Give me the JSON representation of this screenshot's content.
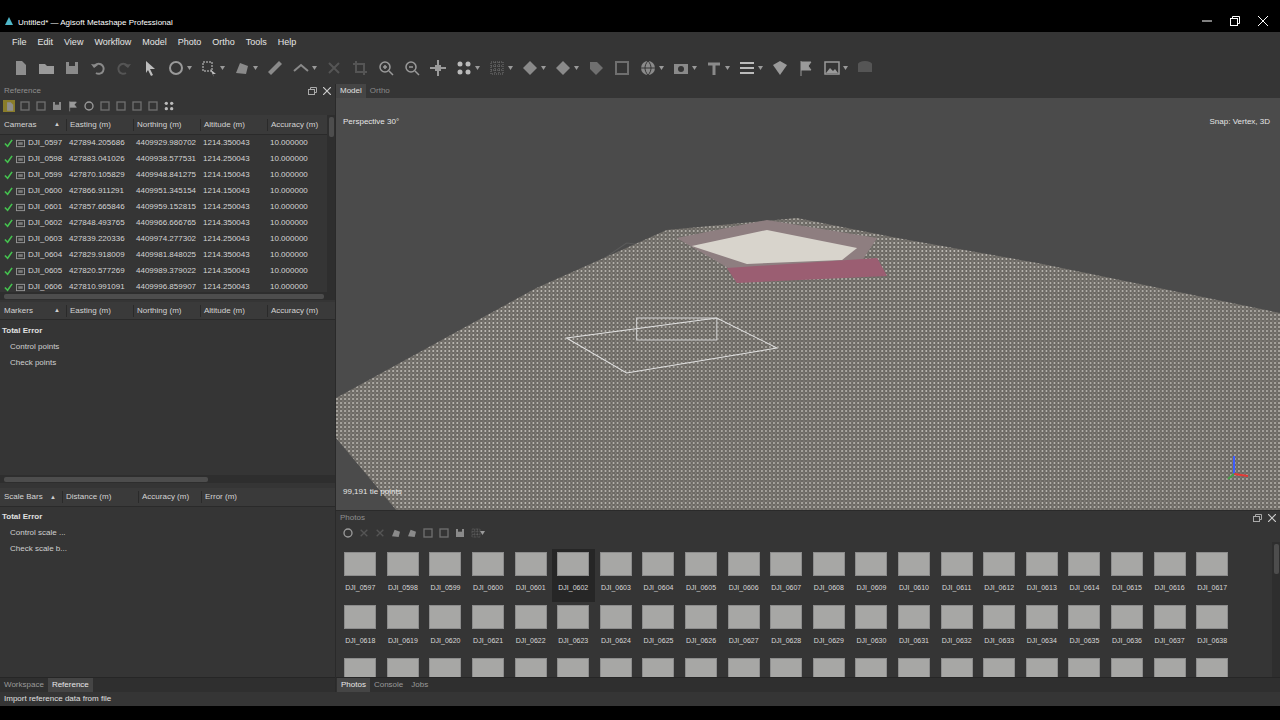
{
  "window": {
    "title": "Untitled* — Agisoft Metashape Professional"
  },
  "menu": [
    "File",
    "Edit",
    "View",
    "Workflow",
    "Model",
    "Photo",
    "Ortho",
    "Tools",
    "Help"
  ],
  "reference": {
    "title": "Reference",
    "import_hovered": true,
    "cameras": {
      "title": "Cameras",
      "sort": "▲",
      "columns": [
        "Easting (m)",
        "Northing (m)",
        "Altitude (m)",
        "Accuracy (m)"
      ],
      "rows": [
        {
          "name": "DJI_0597",
          "checked": true,
          "easting": "427894.205686",
          "northing": "4409929.980702",
          "altitude": "1214.350043",
          "accuracy": "10.000000"
        },
        {
          "name": "DJI_0598",
          "checked": true,
          "easting": "427883.041026",
          "northing": "4409938.577531",
          "altitude": "1214.250043",
          "accuracy": "10.000000"
        },
        {
          "name": "DJI_0599",
          "checked": true,
          "easting": "427870.105829",
          "northing": "4409948.841275",
          "altitude": "1214.150043",
          "accuracy": "10.000000"
        },
        {
          "name": "DJI_0600",
          "checked": true,
          "easting": "427866.911291",
          "northing": "4409951.345154",
          "altitude": "1214.150043",
          "accuracy": "10.000000"
        },
        {
          "name": "DJI_0601",
          "checked": true,
          "easting": "427857.665846",
          "northing": "4409959.152815",
          "altitude": "1214.250043",
          "accuracy": "10.000000"
        },
        {
          "name": "DJI_0602",
          "checked": true,
          "easting": "427848.493765",
          "northing": "4409966.666765",
          "altitude": "1214.350043",
          "accuracy": "10.000000"
        },
        {
          "name": "DJI_0603",
          "checked": true,
          "easting": "427839.220336",
          "northing": "4409974.277302",
          "altitude": "1214.250043",
          "accuracy": "10.000000"
        },
        {
          "name": "DJI_0604",
          "checked": true,
          "easting": "427829.918009",
          "northing": "4409981.848025",
          "altitude": "1214.350043",
          "accuracy": "10.000000"
        },
        {
          "name": "DJI_0605",
          "checked": true,
          "easting": "427820.577269",
          "northing": "4409989.379022",
          "altitude": "1214.350043",
          "accuracy": "10.000000"
        },
        {
          "name": "DJI_0606",
          "checked": true,
          "easting": "427810.991091",
          "northing": "4409996.859907",
          "altitude": "1214.250043",
          "accuracy": "10.000000"
        }
      ]
    },
    "markers": {
      "title": "Markers",
      "sort": "▲",
      "columns": [
        "Easting (m)",
        "Northing (m)",
        "Altitude (m)",
        "Accuracy (m)"
      ],
      "rows": [
        {
          "label": "Total Error",
          "kind": "total"
        },
        {
          "label": "Control points",
          "kind": "item"
        },
        {
          "label": "Check points",
          "kind": "item"
        }
      ]
    },
    "scale_bars": {
      "title": "Scale Bars",
      "sort": "▲",
      "columns": [
        "Distance (m)",
        "Accuracy (m)",
        "Error (m)"
      ],
      "rows": [
        {
          "label": "Total Error",
          "kind": "total"
        },
        {
          "label": "Control scale ...",
          "kind": "item"
        },
        {
          "label": "Check scale b...",
          "kind": "item"
        }
      ]
    }
  },
  "viewport": {
    "tabs": [
      {
        "label": "Model",
        "selected": true
      },
      {
        "label": "Ortho",
        "selected": false
      }
    ],
    "projection": "Perspective 30°",
    "snap": "Snap: Vertex, 3D",
    "points": "99,191 tie points"
  },
  "photos": {
    "title": "Photos",
    "items": [
      {
        "label": "DJI_0597",
        "selected": false
      },
      {
        "label": "DJI_0598",
        "selected": false
      },
      {
        "label": "DJI_0599",
        "selected": false
      },
      {
        "label": "DJI_0600",
        "selected": false
      },
      {
        "label": "DJI_0601",
        "selected": false
      },
      {
        "label": "DJI_0602",
        "selected": true
      },
      {
        "label": "DJI_0603",
        "selected": false
      },
      {
        "label": "DJI_0604",
        "selected": false
      },
      {
        "label": "DJI_0605",
        "selected": false
      },
      {
        "label": "DJI_0606",
        "selected": false
      },
      {
        "label": "DJI_0607",
        "selected": false
      },
      {
        "label": "DJI_0608",
        "selected": false
      },
      {
        "label": "DJI_0609",
        "selected": false
      },
      {
        "label": "DJI_0610",
        "selected": false
      },
      {
        "label": "DJI_0611",
        "selected": false
      },
      {
        "label": "DJI_0612",
        "selected": false
      },
      {
        "label": "DJI_0613",
        "selected": false
      },
      {
        "label": "DJI_0614",
        "selected": false
      },
      {
        "label": "DJI_0615",
        "selected": false
      },
      {
        "label": "DJI_0616",
        "selected": false
      },
      {
        "label": "DJI_0617",
        "selected": false
      },
      {
        "label": "DJI_0618",
        "selected": false
      },
      {
        "label": "DJI_0619",
        "selected": false
      },
      {
        "label": "DJI_0620",
        "selected": false
      },
      {
        "label": "DJI_0621",
        "selected": false
      },
      {
        "label": "DJI_0622",
        "selected": false
      },
      {
        "label": "DJI_0623",
        "selected": false
      },
      {
        "label": "DJI_0624",
        "selected": false
      },
      {
        "label": "DJI_0625",
        "selected": false
      },
      {
        "label": "DJI_0626",
        "selected": false
      },
      {
        "label": "DJI_0627",
        "selected": false
      },
      {
        "label": "DJI_0628",
        "selected": false
      },
      {
        "label": "DJI_0629",
        "selected": false
      },
      {
        "label": "DJI_0630",
        "selected": false
      },
      {
        "label": "DJI_0631",
        "selected": false
      },
      {
        "label": "DJI_0632",
        "selected": false
      },
      {
        "label": "DJI_0633",
        "selected": false
      },
      {
        "label": "DJI_0634",
        "selected": false
      },
      {
        "label": "DJI_0635",
        "selected": false
      },
      {
        "label": "DJI_0636",
        "selected": false
      },
      {
        "label": "DJI_0637",
        "selected": false
      },
      {
        "label": "DJI_0638",
        "selected": false
      }
    ]
  },
  "left_tabs": [
    {
      "label": "Workspace",
      "selected": false
    },
    {
      "label": "Reference",
      "selected": true
    }
  ],
  "bottom_tabs": [
    {
      "label": "Photos",
      "selected": true
    },
    {
      "label": "Console",
      "selected": false
    },
    {
      "label": "Jobs",
      "selected": false
    }
  ],
  "status_bar": "Import reference data from file"
}
